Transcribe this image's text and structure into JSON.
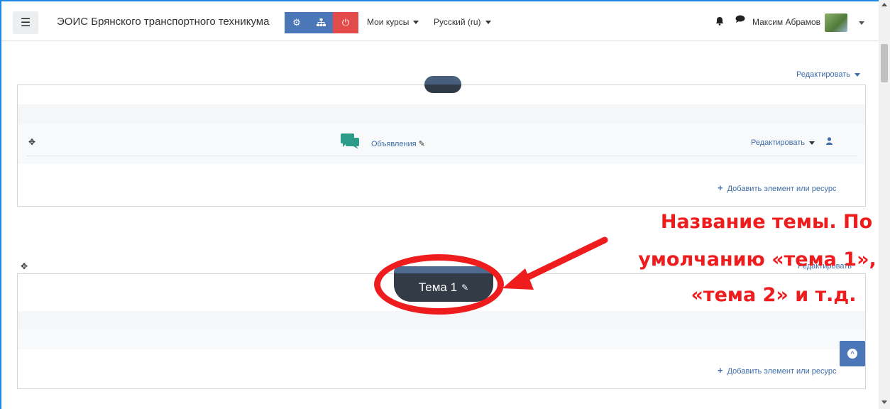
{
  "navbar": {
    "menu_icon": "hamburger-icon",
    "site_title": "ЭОИС Брянского транспортного техникума",
    "buttons": [
      "settings-gears-icon",
      "sitemap-icon",
      "power-icon"
    ],
    "my_courses": "Мои курсы",
    "language": "Русский (ru)",
    "user_name": "Максим Абрамов"
  },
  "section0": {
    "edit_label": "Редактировать",
    "activity": {
      "name": "Объявления",
      "edit_label": "Редактировать"
    },
    "add_resource": "Добавить элемент или ресурс"
  },
  "section1": {
    "title": "Тема 1",
    "edit_label": "Редактировать",
    "add_resource": "Добавить элемент или ресурс"
  },
  "annotation": {
    "line1": "Название темы. По",
    "line2": "умолчанию «тема 1»,",
    "line3": "«тема 2» и т.д.",
    "color": "#ee1c1c"
  },
  "colors": {
    "accent_blue": "#4b77b9",
    "danger_red": "#e34b4b",
    "link_blue": "#3f6ea8"
  }
}
